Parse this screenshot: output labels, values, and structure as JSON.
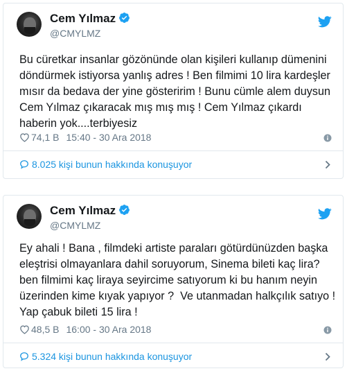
{
  "colors": {
    "text": "#14171a",
    "secondary": "#657786",
    "link": "#1b95e0",
    "border": "#e1e8ed",
    "verified": "#1da1f2"
  },
  "tweets": [
    {
      "author_name": "Cem Yılmaz",
      "author_handle": "@CMYLMZ",
      "text": "Bu cüretkar insanlar gözönünde olan kişileri kullanıp dümenini\ndöndürmek istiyorsa yanlış adres ! Ben filmimi 10 lira kardeşler\nmısır da bedava der yine gösteririm ! Bunu cümle alem duysun\nCem Yılmaz çıkaracak mış mış mış ! Cem Yılmaz çıkardı\nhaberin yok....terbiyesiz",
      "likes": "74,1 B",
      "time": "15:40 - 30 Ara 2018",
      "conversation": "8.025 kişi bunun hakkında konuşuyor",
      "icons": [
        "avatar",
        "verified-badge-icon",
        "twitter-bird-icon",
        "heart-icon",
        "info-icon",
        "speech-bubble-icon",
        "chevron-right-icon"
      ]
    },
    {
      "author_name": "Cem Yılmaz",
      "author_handle": "@CMYLMZ",
      "text": "Ey ahali ! Bana , filmdeki artiste paraları götürdünüzden başka\neleştrisi olmayanlara dahil soruyorum, Sinema bileti kaç lira?\nben filmimi kaç liraya seyircime satıyorum ki bu hanım neyin\nüzerinden kime kıyak yapıyor ?  Ve utanmadan halkçılık satıyo !\nYap çabuk bileti 15 lira !",
      "likes": "48,5 B",
      "time": "16:00 - 30 Ara 2018",
      "conversation": "5.324 kişi bunun hakkında konuşuyor",
      "icons": [
        "avatar",
        "verified-badge-icon",
        "twitter-bird-icon",
        "heart-icon",
        "info-icon",
        "speech-bubble-icon",
        "chevron-right-icon"
      ]
    }
  ]
}
